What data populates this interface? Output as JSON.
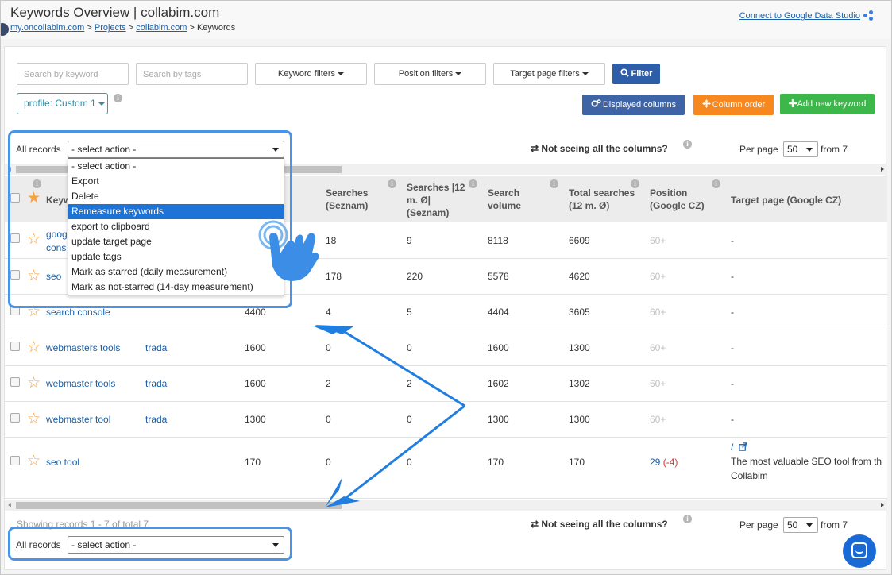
{
  "header": {
    "title": "Keywords Overview | collabim.com",
    "breadcrumb": [
      "my.oncollabim.com",
      "Projects",
      "collabim.com",
      "Keywords"
    ],
    "breadcrumb_sep": ">",
    "gds_link": "Connect to Google Data Studio"
  },
  "toolbar": {
    "search_keyword_placeholder": "Search by keyword",
    "search_tags_placeholder": "Search by tags",
    "keyword_filters": "Keyword filters",
    "position_filters": "Position filters",
    "target_page_filters": "Target page filters",
    "filter_button": "Filter",
    "profile": "profile: Custom 1",
    "displayed_columns": "Displayed columns",
    "column_order": "Column order",
    "add_keyword": "Add new keyword"
  },
  "actions": {
    "all_records_label": "All records",
    "select_value": "- select action -",
    "options": [
      "- select action -",
      "Export",
      "Delete",
      "Remeasure keywords",
      "export to clipboard",
      "update target page",
      "update tags",
      "Mark as starred (daily measurement)",
      "Mark as not-starred (14-day measurement)"
    ],
    "highlighted_index": 3
  },
  "columns_note": "Not seeing all the columns?",
  "pagination": {
    "per_page_label": "Per page",
    "per_page_value": "50",
    "from_label": "from 7"
  },
  "table": {
    "headers": {
      "keyword": "Keyw",
      "searches_seznam": "Searches (Seznam)",
      "searches_12m": "Searches |12 m. Ø| (Seznam)",
      "search_volume": "Search volume",
      "total_searches": "Total searches (12 m. Ø)",
      "position": "Position (Google CZ)",
      "target_page": "Target page (Google CZ)"
    },
    "rows": [
      {
        "keyword": "google search console",
        "keyword_visible": "goog",
        "keyword_line2": "cons",
        "tag": "",
        "searches_google": "",
        "searches_seznam": "18",
        "searches_12m": "9",
        "volume": "8118",
        "total": "6609",
        "position": "60+",
        "position_change": "",
        "target": "-"
      },
      {
        "keyword": "seo",
        "keyword_visible": "seo",
        "keyword_line2": "",
        "tag": "",
        "searches_google": "",
        "searches_seznam": "178",
        "searches_12m": "220",
        "volume": "5578",
        "total": "4620",
        "position": "60+",
        "position_change": "",
        "target": "-"
      },
      {
        "keyword": "search console",
        "keyword_visible": "search console",
        "keyword_line2": "",
        "tag": "",
        "searches_google": "4400",
        "searches_seznam": "4",
        "searches_12m": "5",
        "volume": "4404",
        "total": "3605",
        "position": "60+",
        "position_change": "",
        "target": "-"
      },
      {
        "keyword": "webmasters tools",
        "keyword_visible": "webmasters tools",
        "keyword_line2": "",
        "tag": "trada",
        "searches_google": "1600",
        "searches_seznam": "0",
        "searches_12m": "0",
        "volume": "1600",
        "total": "1300",
        "position": "60+",
        "position_change": "",
        "target": "-"
      },
      {
        "keyword": "webmaster tools",
        "keyword_visible": "webmaster tools",
        "keyword_line2": "",
        "tag": "trada",
        "searches_google": "1600",
        "searches_seznam": "2",
        "searches_12m": "2",
        "volume": "1602",
        "total": "1302",
        "position": "60+",
        "position_change": "",
        "target": "-"
      },
      {
        "keyword": "webmaster tool",
        "keyword_visible": "webmaster tool",
        "keyword_line2": "",
        "tag": "trada",
        "searches_google": "1300",
        "searches_seznam": "0",
        "searches_12m": "0",
        "volume": "1300",
        "total": "1300",
        "position": "60+",
        "position_change": "",
        "target": "-"
      },
      {
        "keyword": "seo tool",
        "keyword_visible": "seo tool",
        "keyword_line2": "",
        "tag": "",
        "searches_google": "170",
        "searches_seznam": "0",
        "searches_12m": "0",
        "volume": "170",
        "total": "170",
        "position": "29",
        "position_change": "(-4)",
        "target_link": "/",
        "target_text_1": "The most valuable SEO tool from th",
        "target_text_2": "Collabim"
      }
    ]
  },
  "footer": {
    "showing": "Showing records 1 - 7 of total 7"
  },
  "colors": {
    "link": "#1a5fa8",
    "highlight_box": "#4a94e8",
    "filter_btn": "#2f5ea8",
    "orange_btn": "#f7871f",
    "green_btn": "#3db64a",
    "star": "#f7a23b",
    "negative": "#d9312b"
  }
}
